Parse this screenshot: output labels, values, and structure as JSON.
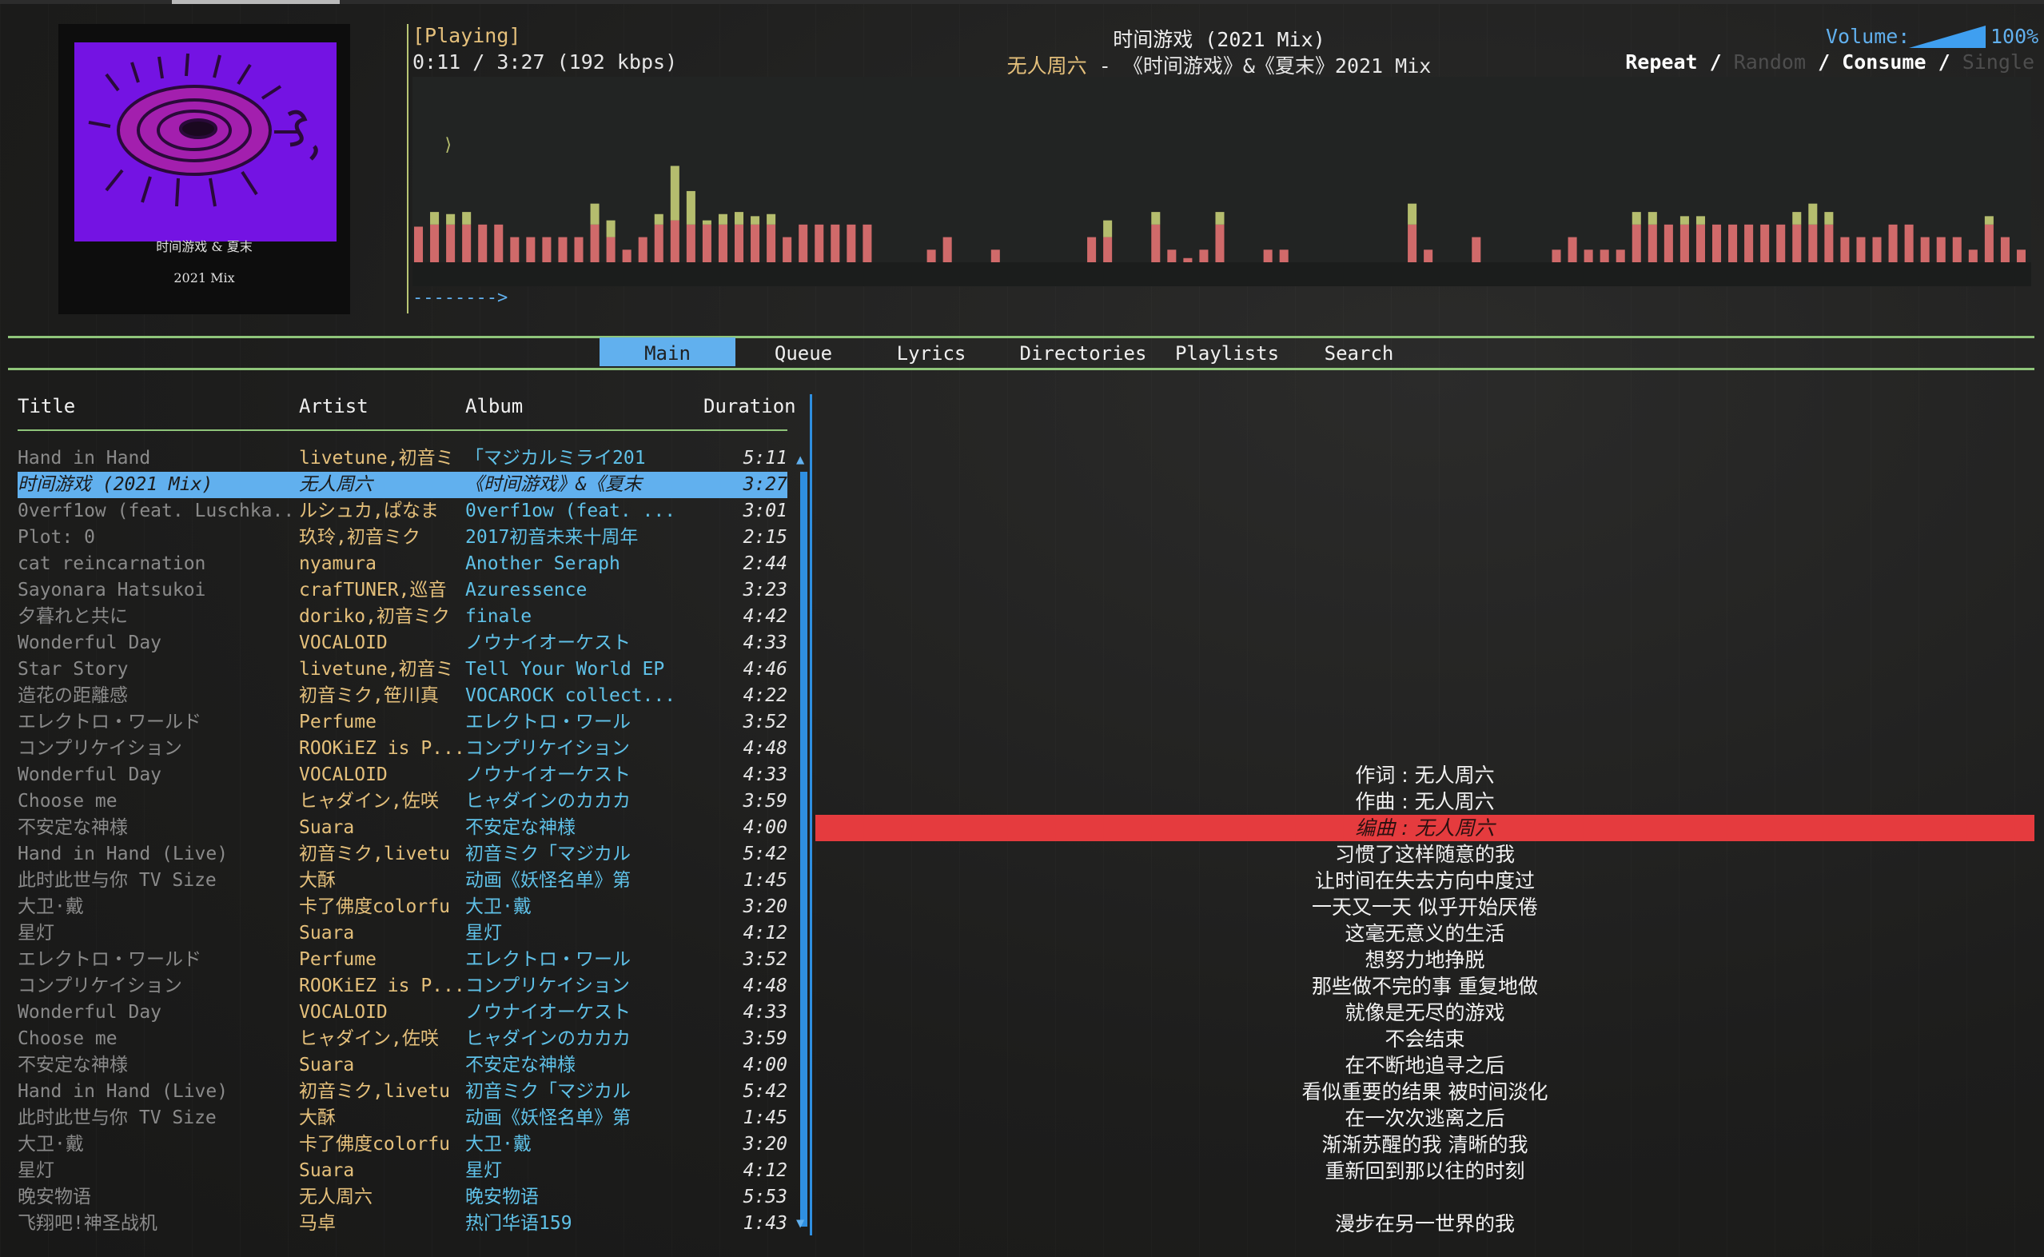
{
  "album_art": {
    "line1": "时间游戏 & 夏末",
    "line2": "2021 Mix"
  },
  "status": "[Playing]",
  "time": "0:11 / 3:27 (192 kbps)",
  "song": {
    "title": "时间游戏 (2021 Mix)",
    "artist": "无人周六",
    "separator": " - ",
    "album": "《时间游戏》&《夏末》2021 Mix"
  },
  "volume": {
    "label": "Volume:",
    "percent": "100%",
    "level": 1.0
  },
  "modes": {
    "repeat": "Repeat",
    "random": "Random",
    "consume": "Consume",
    "single": "Single",
    "sep": " / "
  },
  "progress_arrow": "-------->",
  "tabs": [
    "Main",
    "Queue",
    "Lyrics",
    "Directories",
    "Playlists",
    "Search"
  ],
  "active_tab": "Main",
  "columns": {
    "title": "Title",
    "artist": "Artist",
    "album": "Album",
    "duration": "Duration"
  },
  "colors": {
    "accent": "#61b0ee",
    "green": "#8fc57a",
    "yellow": "#e5c07b",
    "cyan": "#5fc1e8",
    "red": "#e53b3e",
    "bar_red": "#d06a6a",
    "bar_yellow": "#b5bd6e"
  },
  "songs": [
    {
      "title": "Hand in Hand",
      "artist": "livetune,初音ミ",
      "album": "「マジカルミライ201",
      "duration": "5:11"
    },
    {
      "title": "时间游戏 (2021 Mix)",
      "artist": "无人周六",
      "album": "《时间游戏》&《夏末",
      "duration": "3:27"
    },
    {
      "title": "0verf1ow (feat. Luschka...",
      "artist": "ルシュカ,ぱなま",
      "album": "0verf1ow (feat. ...",
      "duration": "3:01"
    },
    {
      "title": "Plot: 0",
      "artist": "玖玲,初音ミク",
      "album": "2017初音未来十周年",
      "duration": "2:15"
    },
    {
      "title": "cat reincarnation",
      "artist": "nyamura",
      "album": "Another Seraph",
      "duration": "2:44"
    },
    {
      "title": "Sayonara Hatsukoi",
      "artist": "crafTUNER,巡音",
      "album": "Azuressence",
      "duration": "3:23"
    },
    {
      "title": "夕暮れと共に",
      "artist": "doriko,初音ミク",
      "album": "finale",
      "duration": "4:42"
    },
    {
      "title": "Wonderful Day",
      "artist": "VOCALOID",
      "album": "ノウナイオーケスト",
      "duration": "4:33"
    },
    {
      "title": "Star Story",
      "artist": "livetune,初音ミ",
      "album": "Tell Your World EP",
      "duration": "4:46"
    },
    {
      "title": "造花の距離感",
      "artist": "初音ミク,笹川真",
      "album": "VOCAROCK collect...",
      "duration": "4:22"
    },
    {
      "title": "エレクトロ・ワールド",
      "artist": "Perfume",
      "album": "エレクトロ・ワール",
      "duration": "3:52"
    },
    {
      "title": "コンプリケイション",
      "artist": "ROOKiEZ is P...",
      "album": "コンプリケイション",
      "duration": "4:48"
    },
    {
      "title": "Wonderful Day",
      "artist": "VOCALOID",
      "album": "ノウナイオーケスト",
      "duration": "4:33"
    },
    {
      "title": "Choose me",
      "artist": "ヒャダイン,佐咲",
      "album": "ヒャダインのカカカ",
      "duration": "3:59"
    },
    {
      "title": "不安定な神様",
      "artist": "Suara",
      "album": "不安定な神様",
      "duration": "4:00"
    },
    {
      "title": "Hand in Hand (Live)",
      "artist": "初音ミク,livetu",
      "album": "初音ミク「マジカル",
      "duration": "5:42"
    },
    {
      "title": "此时此世与你 TV Size",
      "artist": "大酥",
      "album": "动画《妖怪名单》第",
      "duration": "1:45"
    },
    {
      "title": "大卫·戴",
      "artist": "卡了佛度colorfu",
      "album": "大卫·戴",
      "duration": "3:20"
    },
    {
      "title": "星灯",
      "artist": "Suara",
      "album": "星灯",
      "duration": "4:12"
    },
    {
      "title": "エレクトロ・ワールド",
      "artist": "Perfume",
      "album": "エレクトロ・ワール",
      "duration": "3:52"
    },
    {
      "title": "コンプリケイション",
      "artist": "ROOKiEZ is P...",
      "album": "コンプリケイション",
      "duration": "4:48"
    },
    {
      "title": "Wonderful Day",
      "artist": "VOCALOID",
      "album": "ノウナイオーケスト",
      "duration": "4:33"
    },
    {
      "title": "Choose me",
      "artist": "ヒャダイン,佐咲",
      "album": "ヒャダインのカカカ",
      "duration": "3:59"
    },
    {
      "title": "不安定な神様",
      "artist": "Suara",
      "album": "不安定な神様",
      "duration": "4:00"
    },
    {
      "title": "Hand in Hand (Live)",
      "artist": "初音ミク,livetu",
      "album": "初音ミク「マジカル",
      "duration": "5:42"
    },
    {
      "title": "此时此世与你 TV Size",
      "artist": "大酥",
      "album": "动画《妖怪名单》第",
      "duration": "1:45"
    },
    {
      "title": "大卫·戴",
      "artist": "卡了佛度colorfu",
      "album": "大卫·戴",
      "duration": "3:20"
    },
    {
      "title": "星灯",
      "artist": "Suara",
      "album": "星灯",
      "duration": "4:12"
    },
    {
      "title": "晚安物语",
      "artist": "无人周六",
      "album": "晚安物语",
      "duration": "5:53"
    },
    {
      "title": "飞翔吧!神圣战机",
      "artist": "马卓",
      "album": "热门华语159",
      "duration": "1:43"
    }
  ],
  "selected_index": 1,
  "lyrics": [
    "作词 : 无人周六",
    "作曲 : 无人周六",
    "编曲 : 无人周六",
    "习惯了这样随意的我",
    "让时间在失去方向中度过",
    "一天又一天 似乎开始厌倦",
    "这毫无意义的生活",
    "想努力地挣脱",
    "那些做不完的事 重复地做",
    "就像是无尽的游戏",
    "不会结束",
    "在不断地追寻之后",
    "看似重要的结果 被时间淡化",
    "在一次次逃离之后",
    "渐渐苏醒的我 清晰的我",
    "重新回到那以往的时刻",
    "",
    "漫步在另一世界的我"
  ],
  "current_lyric_index": 2,
  "spectrum": {
    "red": [
      0.17,
      0.18,
      0.18,
      0.18,
      0.18,
      0.18,
      0.12,
      0.12,
      0.12,
      0.12,
      0.12,
      0.18,
      0.12,
      0.06,
      0.12,
      0.18,
      0.2,
      0.18,
      0.18,
      0.18,
      0.18,
      0.18,
      0.18,
      0.12,
      0.18,
      0.18,
      0.18,
      0.18,
      0.18,
      0,
      0,
      0,
      0.06,
      0.12,
      0,
      0,
      0.06,
      0,
      0,
      0,
      0,
      0,
      0.12,
      0.12,
      0,
      0,
      0.18,
      0.06,
      0.02,
      0.06,
      0.18,
      0,
      0,
      0.06,
      0.06,
      0,
      0,
      0,
      0,
      0,
      0,
      0,
      0.18,
      0.06,
      0,
      0,
      0.12,
      0,
      0,
      0,
      0,
      0.06,
      0.12,
      0.06,
      0.06,
      0.06,
      0.18,
      0.18,
      0.18,
      0.18,
      0.18,
      0.18,
      0.18,
      0.18,
      0.18,
      0.18,
      0.18,
      0.18,
      0.18,
      0.12,
      0.12,
      0.12,
      0.18,
      0.18,
      0.12,
      0.12,
      0.12,
      0.06,
      0.18,
      0.12,
      0.06
    ],
    "yellow": [
      0,
      0.06,
      0.05,
      0.06,
      0,
      0,
      0,
      0,
      0,
      0,
      0,
      0.1,
      0.08,
      0,
      0,
      0.05,
      0.26,
      0.16,
      0.02,
      0.05,
      0.06,
      0.04,
      0.05,
      0,
      0,
      0,
      0,
      0,
      0,
      0,
      0,
      0,
      0,
      0,
      0,
      0,
      0,
      0,
      0,
      0,
      0,
      0,
      0,
      0.08,
      0,
      0,
      0.06,
      0,
      0,
      0,
      0.06,
      0,
      0,
      0,
      0,
      0,
      0,
      0,
      0,
      0,
      0,
      0,
      0.1,
      0,
      0,
      0,
      0,
      0,
      0,
      0,
      0,
      0,
      0,
      0,
      0,
      0,
      0.06,
      0.06,
      0,
      0.04,
      0.04,
      0,
      0,
      0,
      0,
      0,
      0.06,
      0.1,
      0.06,
      0,
      0,
      0,
      0,
      0,
      0,
      0,
      0,
      0,
      0.04,
      0,
      0
    ]
  }
}
